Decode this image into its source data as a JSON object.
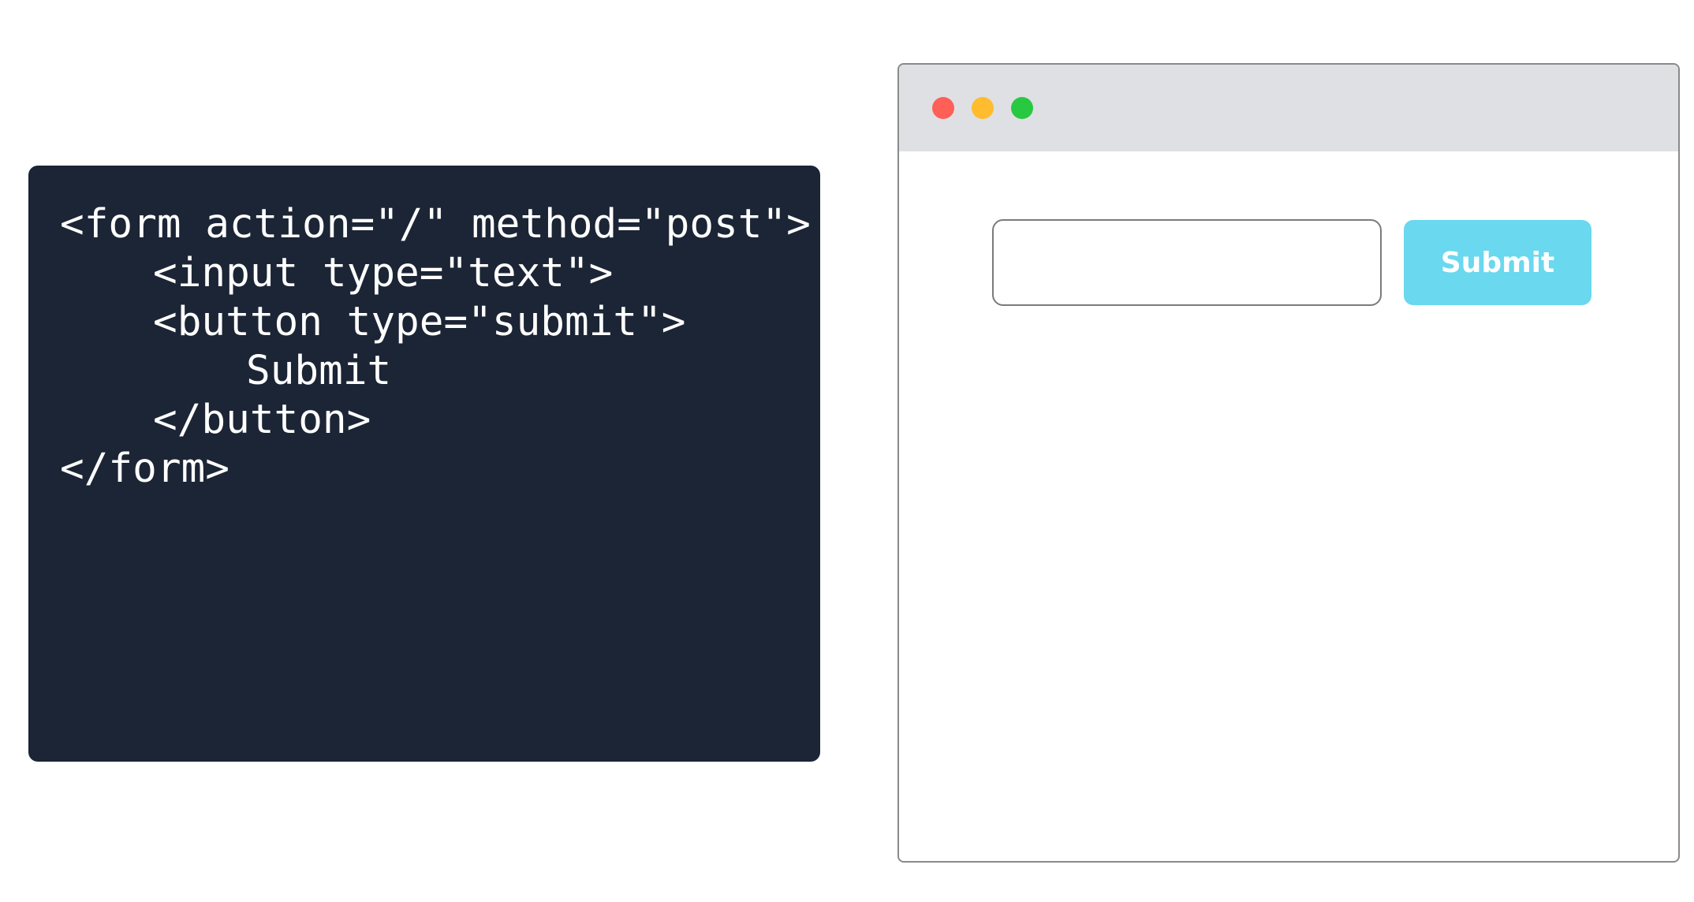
{
  "code": {
    "lines": [
      "<form action=\"/\" method=\"post\">",
      "<input type=\"text\">",
      "<button type=\"submit\">",
      "Submit",
      "</button>",
      "</form>"
    ],
    "background": "#1c2535",
    "text_color": "#ffffff"
  },
  "browser": {
    "window_controls": {
      "close_color": "#fe5f57",
      "minimize_color": "#febc2e",
      "maximize_color": "#28c840"
    },
    "input": {
      "value": ""
    },
    "submit_button": {
      "label": "Submit",
      "color": "#6ad8ee"
    }
  }
}
